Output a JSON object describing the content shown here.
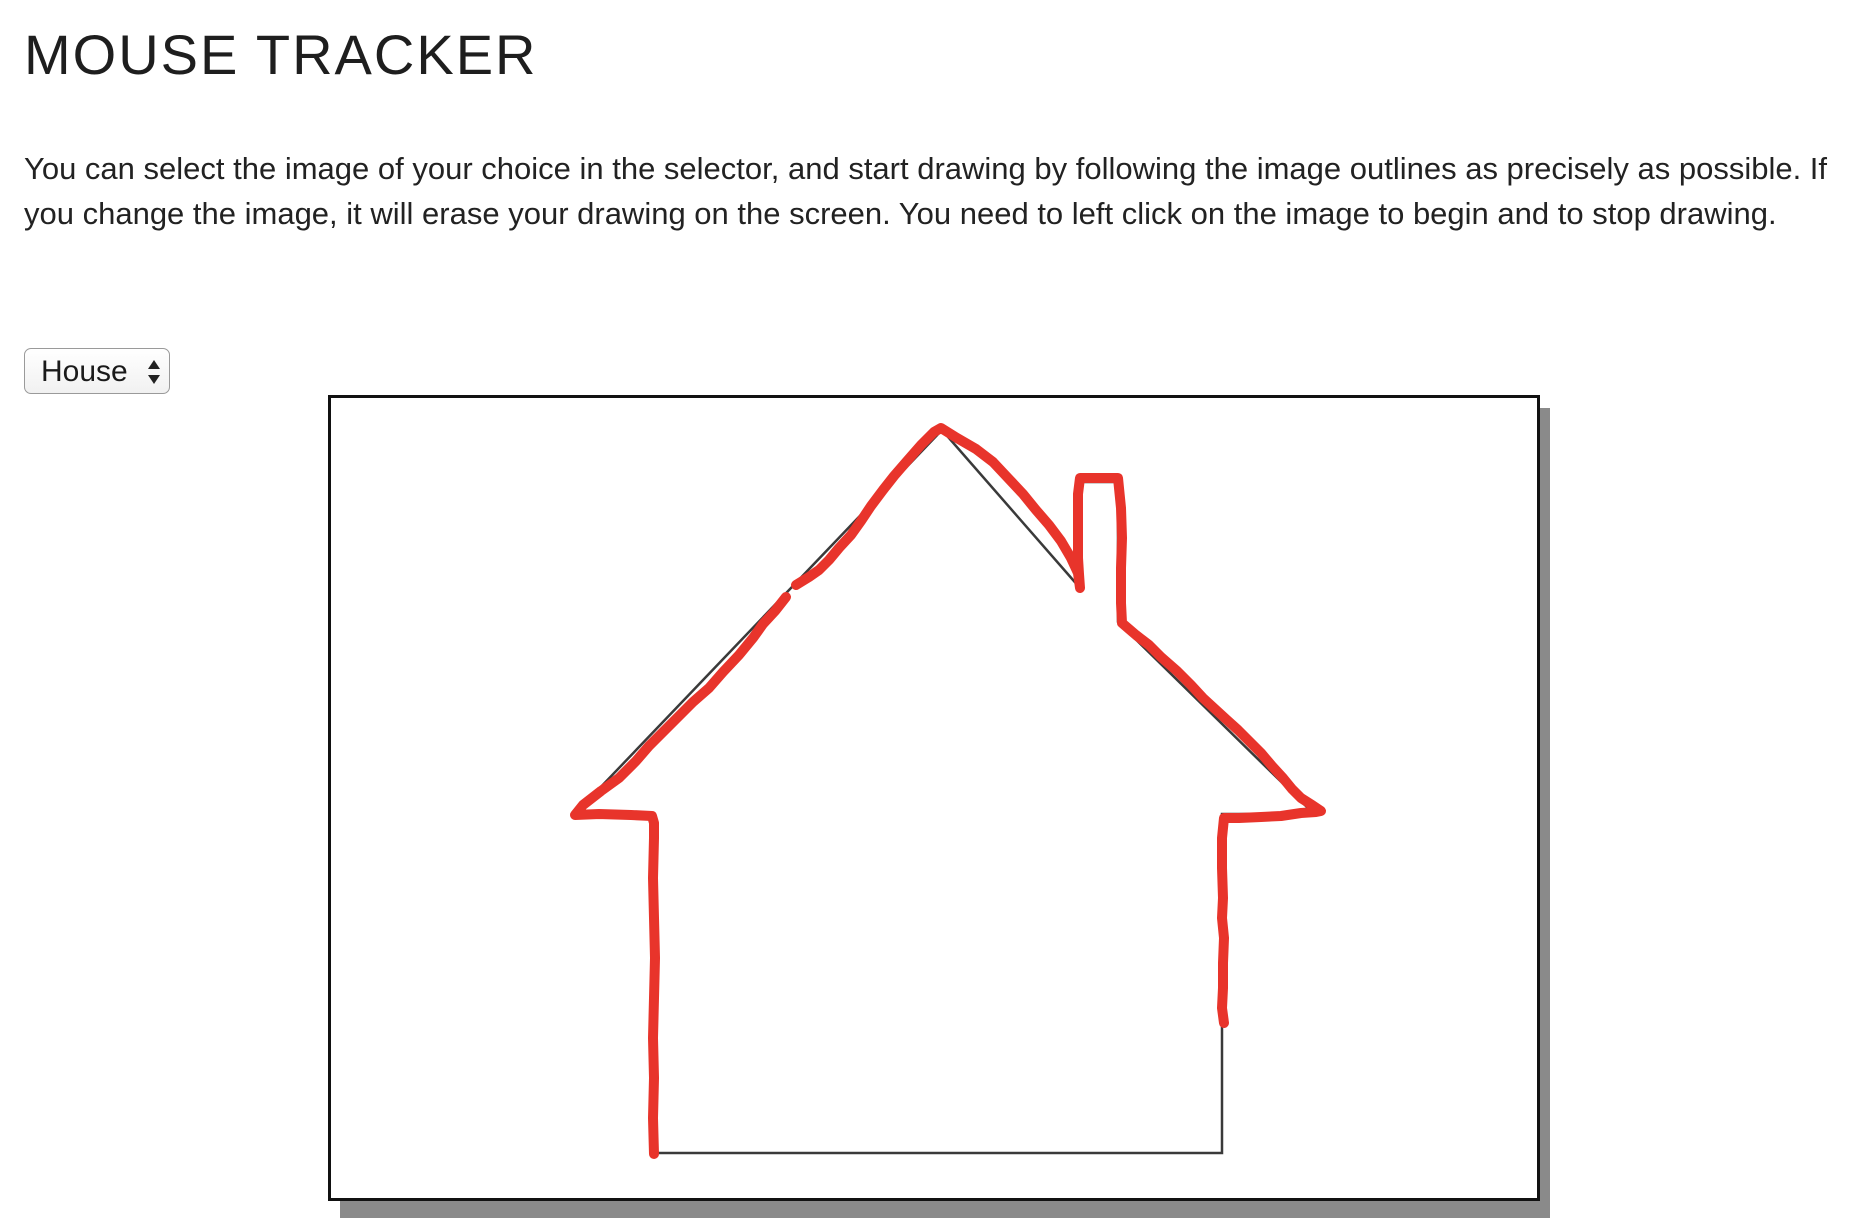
{
  "page": {
    "title": "MOUSE TRACKER",
    "instructions": "You can select the image of your choice in the selector, and start drawing by following the image outlines as precisely as possible. If you change the image, it will erase your drawing on the screen. You need to left click on the image to begin and to stop drawing."
  },
  "image_selector": {
    "selected": "House",
    "icon": "up-down-arrows-icon"
  },
  "canvas": {
    "template_image": "house-outline",
    "stroke_color": "#e8342b",
    "outline_color": "#3a3a3a",
    "shadow_color": "#8a8a8a"
  }
}
